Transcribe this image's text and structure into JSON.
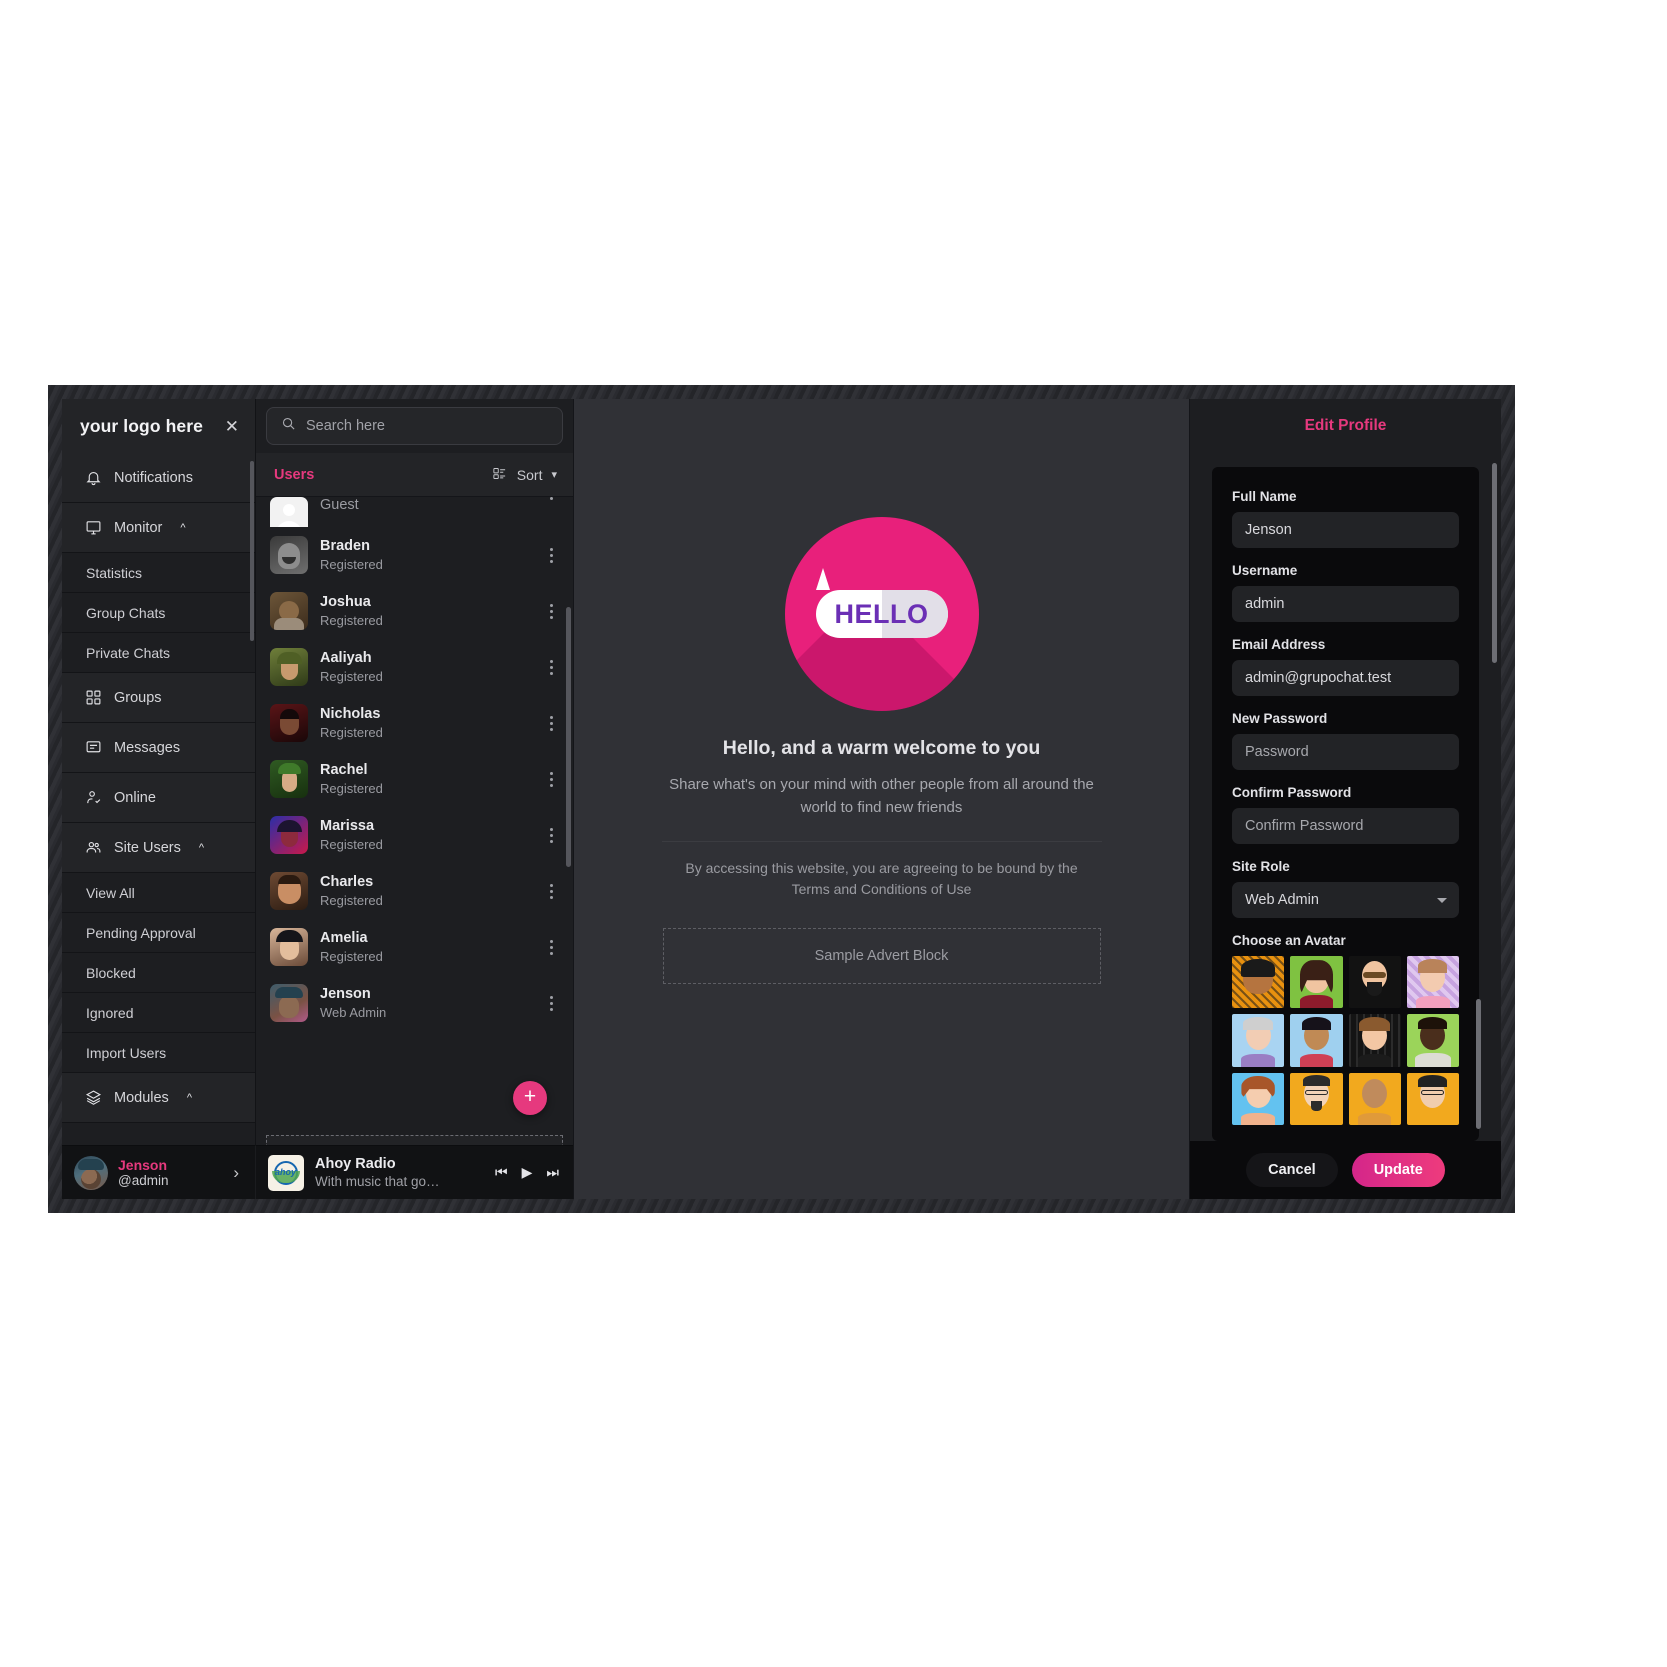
{
  "brand": {
    "logo_text": "your logo here",
    "close_icon": "close-icon"
  },
  "sidebar": {
    "items": [
      {
        "label": "Notifications",
        "icon": "bell-icon",
        "type": "group",
        "expandable": false
      },
      {
        "label": "Monitor",
        "icon": "monitor-icon",
        "type": "group",
        "expandable": true,
        "caret": "^"
      },
      {
        "label": "Statistics",
        "type": "sub"
      },
      {
        "label": "Group Chats",
        "type": "sub"
      },
      {
        "label": "Private Chats",
        "type": "sub"
      },
      {
        "label": "Groups",
        "icon": "grid-icon",
        "type": "group",
        "expandable": false
      },
      {
        "label": "Messages",
        "icon": "message-icon",
        "type": "group",
        "expandable": false
      },
      {
        "label": "Online",
        "icon": "user-check-icon",
        "type": "group",
        "expandable": false
      },
      {
        "label": "Site Users",
        "icon": "users-icon",
        "type": "group",
        "expandable": true,
        "caret": "^"
      },
      {
        "label": "View All",
        "type": "sub"
      },
      {
        "label": "Pending Approval",
        "type": "sub"
      },
      {
        "label": "Blocked",
        "type": "sub"
      },
      {
        "label": "Ignored",
        "type": "sub"
      },
      {
        "label": "Import Users",
        "type": "sub"
      },
      {
        "label": "Modules",
        "icon": "layers-icon",
        "type": "group",
        "expandable": true,
        "caret": "^"
      }
    ],
    "footer": {
      "name": "Jenson",
      "handle": "@admin",
      "chevron": "›"
    }
  },
  "search": {
    "placeholder": "Search here",
    "icon": "search-icon"
  },
  "user_list": {
    "title": "Users",
    "sort_label": "Sort",
    "layout_icon": "list-layout-icon",
    "sort_caret_icon": "chevron-down-icon",
    "add_button_label": "+",
    "advert_label": "Sample Advert Block",
    "users": [
      {
        "name": "Guest",
        "role": "",
        "avatar": "guest",
        "partial": true
      },
      {
        "name": "Braden",
        "role": "Registered",
        "avatar": "braden"
      },
      {
        "name": "Joshua",
        "role": "Registered",
        "avatar": "joshua"
      },
      {
        "name": "Aaliyah",
        "role": "Registered",
        "avatar": "aaliyah"
      },
      {
        "name": "Nicholas",
        "role": "Registered",
        "avatar": "nicholas"
      },
      {
        "name": "Rachel",
        "role": "Registered",
        "avatar": "rachel"
      },
      {
        "name": "Marissa",
        "role": "Registered",
        "avatar": "marissa"
      },
      {
        "name": "Charles",
        "role": "Registered",
        "avatar": "charles"
      },
      {
        "name": "Amelia",
        "role": "Registered",
        "avatar": "amelia"
      },
      {
        "name": "Jenson",
        "role": "Web Admin",
        "avatar": "jenson"
      }
    ]
  },
  "main": {
    "logo_text": "HELLO",
    "heading": "Hello, and a warm welcome to you",
    "subtext": "Share what's on your mind with other people from all around the world to find new friends",
    "terms": "By accessing this website, you are agreeing to be bound by the Terms and Conditions of Use",
    "advert_label": "Sample Advert Block"
  },
  "radio": {
    "title": "Ahoy Radio",
    "description": "With music that go…",
    "logo_text": "ahoy",
    "prev_icon": "skip-back-icon",
    "play_icon": "play-icon",
    "next_icon": "skip-forward-icon",
    "prev_glyph": "⏮",
    "play_glyph": "▶",
    "next_glyph": "⏭"
  },
  "edit_profile": {
    "title": "Edit Profile",
    "fields": [
      {
        "label": "Full Name",
        "value": "Jenson",
        "placeholder": "Full Name",
        "type": "text"
      },
      {
        "label": "Username",
        "value": "admin",
        "placeholder": "Username",
        "type": "text"
      },
      {
        "label": "Email Address",
        "value": "admin@grupochat.test",
        "placeholder": "Email Address",
        "type": "text"
      },
      {
        "label": "New Password",
        "value": "",
        "placeholder": "Password",
        "type": "password"
      },
      {
        "label": "Confirm Password",
        "value": "",
        "placeholder": "Confirm Password",
        "type": "password"
      },
      {
        "label": "Site Role",
        "value": "Web Admin",
        "placeholder": "Site Role",
        "type": "select"
      }
    ],
    "avatar_section_label": "Choose an Avatar",
    "cancel_label": "Cancel",
    "update_label": "Update"
  },
  "colors": {
    "accent_pink": "#e6397e",
    "logo_pink": "#e8207b",
    "panel_dark": "#1d1e21",
    "card_black": "#0a0a0c"
  }
}
